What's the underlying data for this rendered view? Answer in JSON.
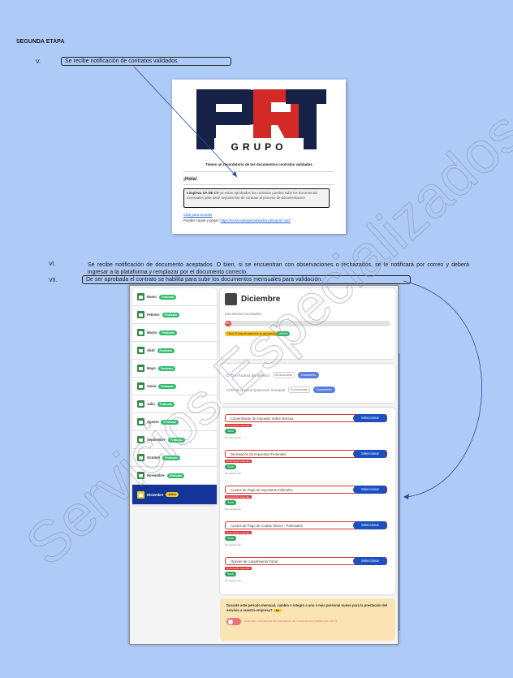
{
  "section_title": "SEGUNDA ETAPA",
  "items": [
    {
      "num": "V.",
      "text": "Se recibe notificación de contratos validados"
    },
    {
      "num": "VI.",
      "text": "Se recibe notificación de documento aceptados. O bien, si se encuentran con observaciones o rechazados, se le notificará por correo y deberá ingresar a la plataforma y remplazar por el documento correcto."
    },
    {
      "num": "VII.",
      "text": "De ser aprobada el contrato se habilita para subir los documentos mensuales para validación."
    }
  ],
  "email": {
    "logo_text": "PRT",
    "logo_sub": "GRUPO",
    "reminder": "Tienes un recordatorio de los documentos contratos validados",
    "greeting": "¡Hola!",
    "company": "Limpieza SA DE CV",
    "message": "ya estan aprobados los contratos puedes subir los documentos mensuales para darle seguimiento de contrato al proceso de documentacion",
    "link": "Click para acceder",
    "copy_label": "Puedes copiar y pegar:",
    "copy_url": "https://serviciosespecializados.prtsoport.com/"
  },
  "portal": {
    "months": [
      {
        "name": "Enero",
        "status": "Finalizado"
      },
      {
        "name": "Febrero",
        "status": "Finalizado"
      },
      {
        "name": "Marzo",
        "status": "Finalizado"
      },
      {
        "name": "Abril",
        "status": "Finalizado"
      },
      {
        "name": "Mayo",
        "status": "Finalizado"
      },
      {
        "name": "Junio",
        "status": "Finalizado"
      },
      {
        "name": "Julio",
        "status": "Finalizado"
      },
      {
        "name": "Agosto",
        "status": "Finalizado"
      },
      {
        "name": "Septiembre",
        "status": "Finalizado"
      },
      {
        "name": "Octubre",
        "status": "Finalizado"
      },
      {
        "name": "Noviembre",
        "status": "Finalizado"
      },
      {
        "name": "Diciembre",
        "status": "Activo"
      }
    ],
    "header": {
      "title": "Diciembre",
      "subtitle": "Documentos mensuales",
      "progress_pct_label": "0%",
      "progress": 0.02,
      "warning": "Tiene 26 días de estar todo su documentación",
      "pending": "Abierta"
    },
    "cfdi": [
      {
        "label": "CFDI o Factura del Servicio",
        "sin": "Sin documento",
        "btn": "Documento"
      },
      {
        "label": "CFDI de Nomina Quincenal, Semanal",
        "sin": "Sin documento",
        "btn": "Documento"
      }
    ],
    "docs": [
      {
        "label": "Comprobante de Impuesto Sobre Nómina"
      },
      {
        "label": "Declaración de Impuestos Federales"
      },
      {
        "label": "Acuses de Pago de Impuestos Federales"
      },
      {
        "label": "Acuses de Pago de Cuotas Obrero - Patronales"
      },
      {
        "label": "Opinión de cumplimiento Fiscal"
      }
    ],
    "doc_select": "Seleccionar",
    "doc_required": "Documento requerido",
    "doc_upload": "Subir",
    "doc_none": "Sin documento",
    "question": "Durante este periodo mensual, cambio o integro a uno o más personal nuevo para la prestación del servicio a nuestra empresa?",
    "question_answer": "No",
    "toggle_label": "Adjuntar Constancia de prestación de movimientos afiliatorios IMSS"
  },
  "watermark": "Servicios Especializados"
}
